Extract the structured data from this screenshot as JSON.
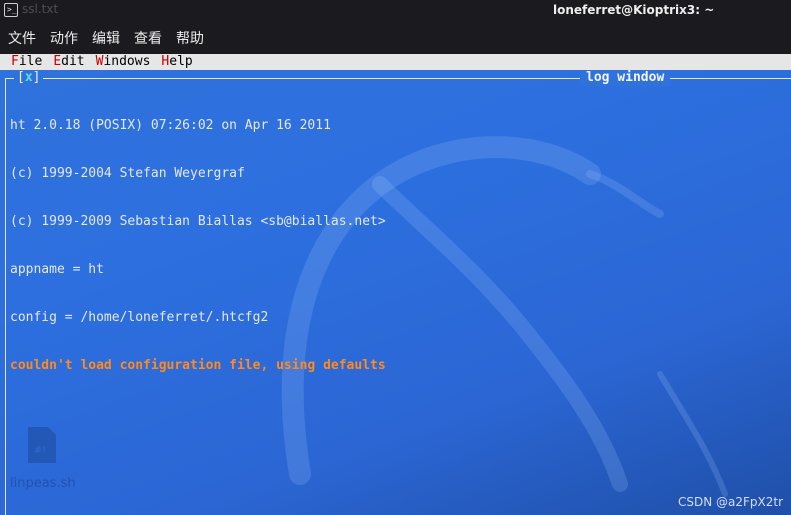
{
  "window": {
    "ghost_title": "ssl.txt",
    "title": "loneferret@Kioptrix3: ~"
  },
  "menubar": [
    {
      "label": "文件"
    },
    {
      "label": "动作"
    },
    {
      "label": "编辑"
    },
    {
      "label": "查看"
    },
    {
      "label": "帮助"
    }
  ],
  "ht_menu": [
    {
      "hot": "F",
      "rest": "ile"
    },
    {
      "hot": "E",
      "rest": "dit"
    },
    {
      "hot": "W",
      "rest": "indows"
    },
    {
      "hot": "H",
      "rest": "elp"
    }
  ],
  "log_window": {
    "close_open": "[",
    "close_x": "x",
    "close_close": "]",
    "title": "log window",
    "lines": [
      "ht 2.0.18 (POSIX) 07:26:02 on Apr 16 2011",
      "(c) 1999-2004 Stefan Weyergraf",
      "(c) 1999-2009 Sebastian Biallas <sb@biallas.net>",
      "appname = ht",
      "config = /home/loneferret/.htcfg2"
    ],
    "warning": "couldn't load configuration file, using defaults"
  },
  "desktop": {
    "icon_label": "linpeas.sh"
  },
  "watermark": "CSDN @a2FpX2tr",
  "colors": {
    "terminal_bg": "#2f72dc",
    "warning": "#ff8a1e",
    "hotkey": "#c80000",
    "menu_bg": "#e6e6e6"
  }
}
